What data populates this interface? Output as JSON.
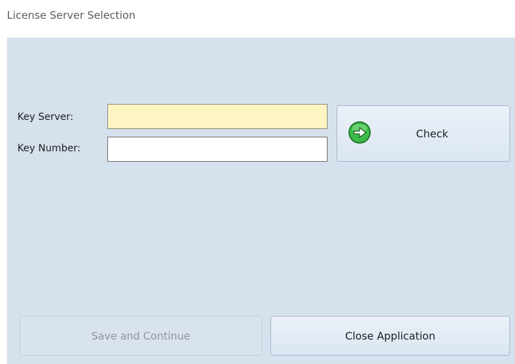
{
  "window": {
    "title": "License Server Selection"
  },
  "form": {
    "key_server_label": "Key Server:",
    "key_server_value": "",
    "key_number_label": "Key Number:",
    "key_number_value": ""
  },
  "buttons": {
    "check_label": "Check",
    "check_icon": "green-arrow-right-icon",
    "save_label": "Save and Continue",
    "save_enabled": false,
    "close_label": "Close Application"
  },
  "colors": {
    "panel_background": "#d6e1ee",
    "focused_field": "#fff5c2",
    "check_icon_green": "#2faa3a"
  }
}
